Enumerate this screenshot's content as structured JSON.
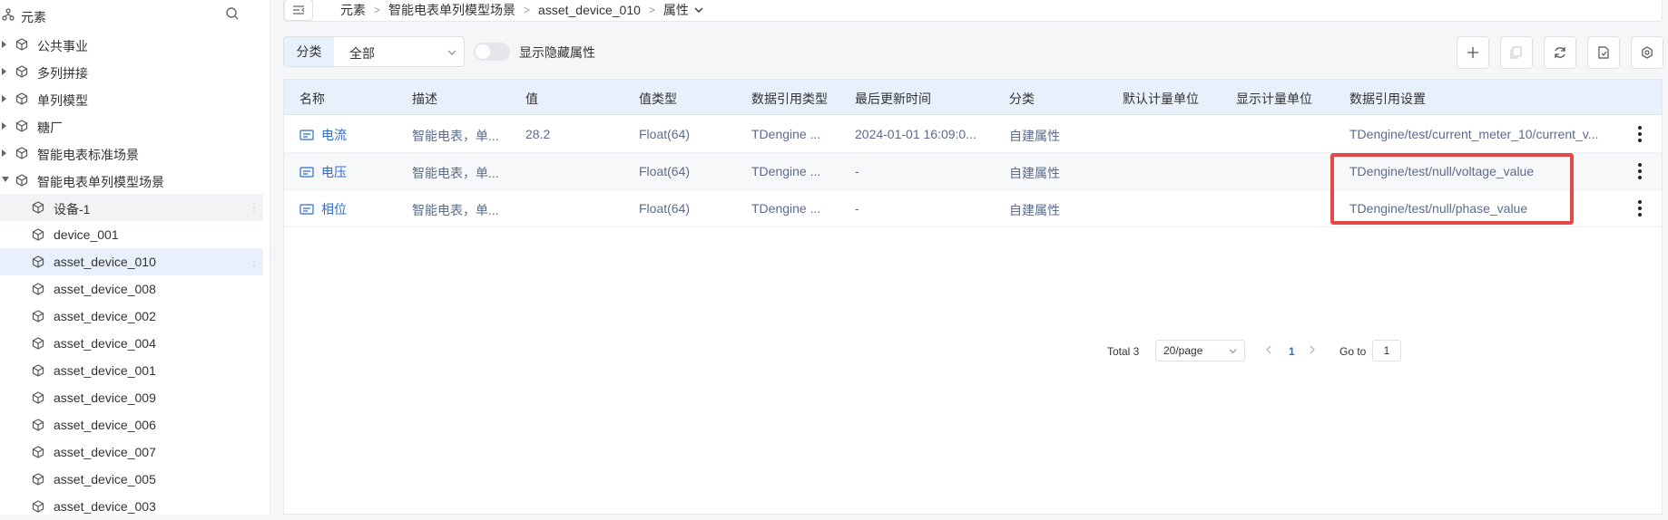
{
  "sidebar": {
    "root_label": "元素",
    "items": [
      {
        "label": "公共事业",
        "level": 0,
        "expanded": false
      },
      {
        "label": "多列拼接",
        "level": 0,
        "expanded": false
      },
      {
        "label": "单列模型",
        "level": 0,
        "expanded": false
      },
      {
        "label": "糖厂",
        "level": 0,
        "expanded": false
      },
      {
        "label": "智能电表标准场景",
        "level": 0,
        "expanded": false
      },
      {
        "label": "智能电表单列模型场景",
        "level": 0,
        "expanded": true
      },
      {
        "label": "设备-1",
        "level": 1,
        "state": "hover"
      },
      {
        "label": "device_001",
        "level": 1
      },
      {
        "label": "asset_device_010",
        "level": 1,
        "state": "selected"
      },
      {
        "label": "asset_device_008",
        "level": 1
      },
      {
        "label": "asset_device_002",
        "level": 1
      },
      {
        "label": "asset_device_004",
        "level": 1
      },
      {
        "label": "asset_device_001",
        "level": 1
      },
      {
        "label": "asset_device_009",
        "level": 1
      },
      {
        "label": "asset_device_006",
        "level": 1
      },
      {
        "label": "asset_device_007",
        "level": 1
      },
      {
        "label": "asset_device_005",
        "level": 1
      },
      {
        "label": "asset_device_003",
        "level": 1
      }
    ]
  },
  "breadcrumb": [
    "元素",
    "智能电表单列模型场景",
    "asset_device_010",
    "属性"
  ],
  "toolbar": {
    "filter_tag": "分类",
    "filter_value": "全部",
    "toggle_label": "显示隐藏属性",
    "toggle_on": false
  },
  "table": {
    "columns": [
      "名称",
      "描述",
      "值",
      "值类型",
      "数据引用类型",
      "最后更新时间",
      "分类",
      "默认计量单位",
      "显示计量单位",
      "数据引用设置"
    ],
    "rows": [
      {
        "name": "电流",
        "desc": "智能电表，单...",
        "value": "28.2",
        "value_type": "Float(64)",
        "ref_type": "TDengine ...",
        "updated": "2024-01-01 16:09:0...",
        "category": "自建属性",
        "default_unit": "",
        "display_unit": "",
        "ref_setting": "TDengine/test/current_meter_10/current_v..."
      },
      {
        "name": "电压",
        "desc": "智能电表，单...",
        "value": "",
        "value_type": "Float(64)",
        "ref_type": "TDengine ...",
        "updated": "-",
        "category": "自建属性",
        "default_unit": "",
        "display_unit": "",
        "ref_setting": "TDengine/test/null/voltage_value"
      },
      {
        "name": "相位",
        "desc": "智能电表，单...",
        "value": "",
        "value_type": "Float(64)",
        "ref_type": "TDengine ...",
        "updated": "-",
        "category": "自建属性",
        "default_unit": "",
        "display_unit": "",
        "ref_setting": "TDengine/test/null/phase_value"
      }
    ]
  },
  "pagination": {
    "total_label": "Total 3",
    "page_size": "20/page",
    "current_page": "1",
    "goto_label": "Go to",
    "goto_value": "1"
  },
  "colors": {
    "accent": "#2e6bd3",
    "header_bg": "#e8f0fb",
    "annotation_red": "#e54848"
  },
  "icons": [
    "tree-root-icon",
    "search-icon",
    "caret-right-icon",
    "caret-down-icon",
    "cube-icon",
    "collapse-menu-icon",
    "chevron-down-icon",
    "plus-icon",
    "copy-icon",
    "refresh-icon",
    "export-icon",
    "settings-icon",
    "field-icon",
    "more-vertical-icon"
  ]
}
